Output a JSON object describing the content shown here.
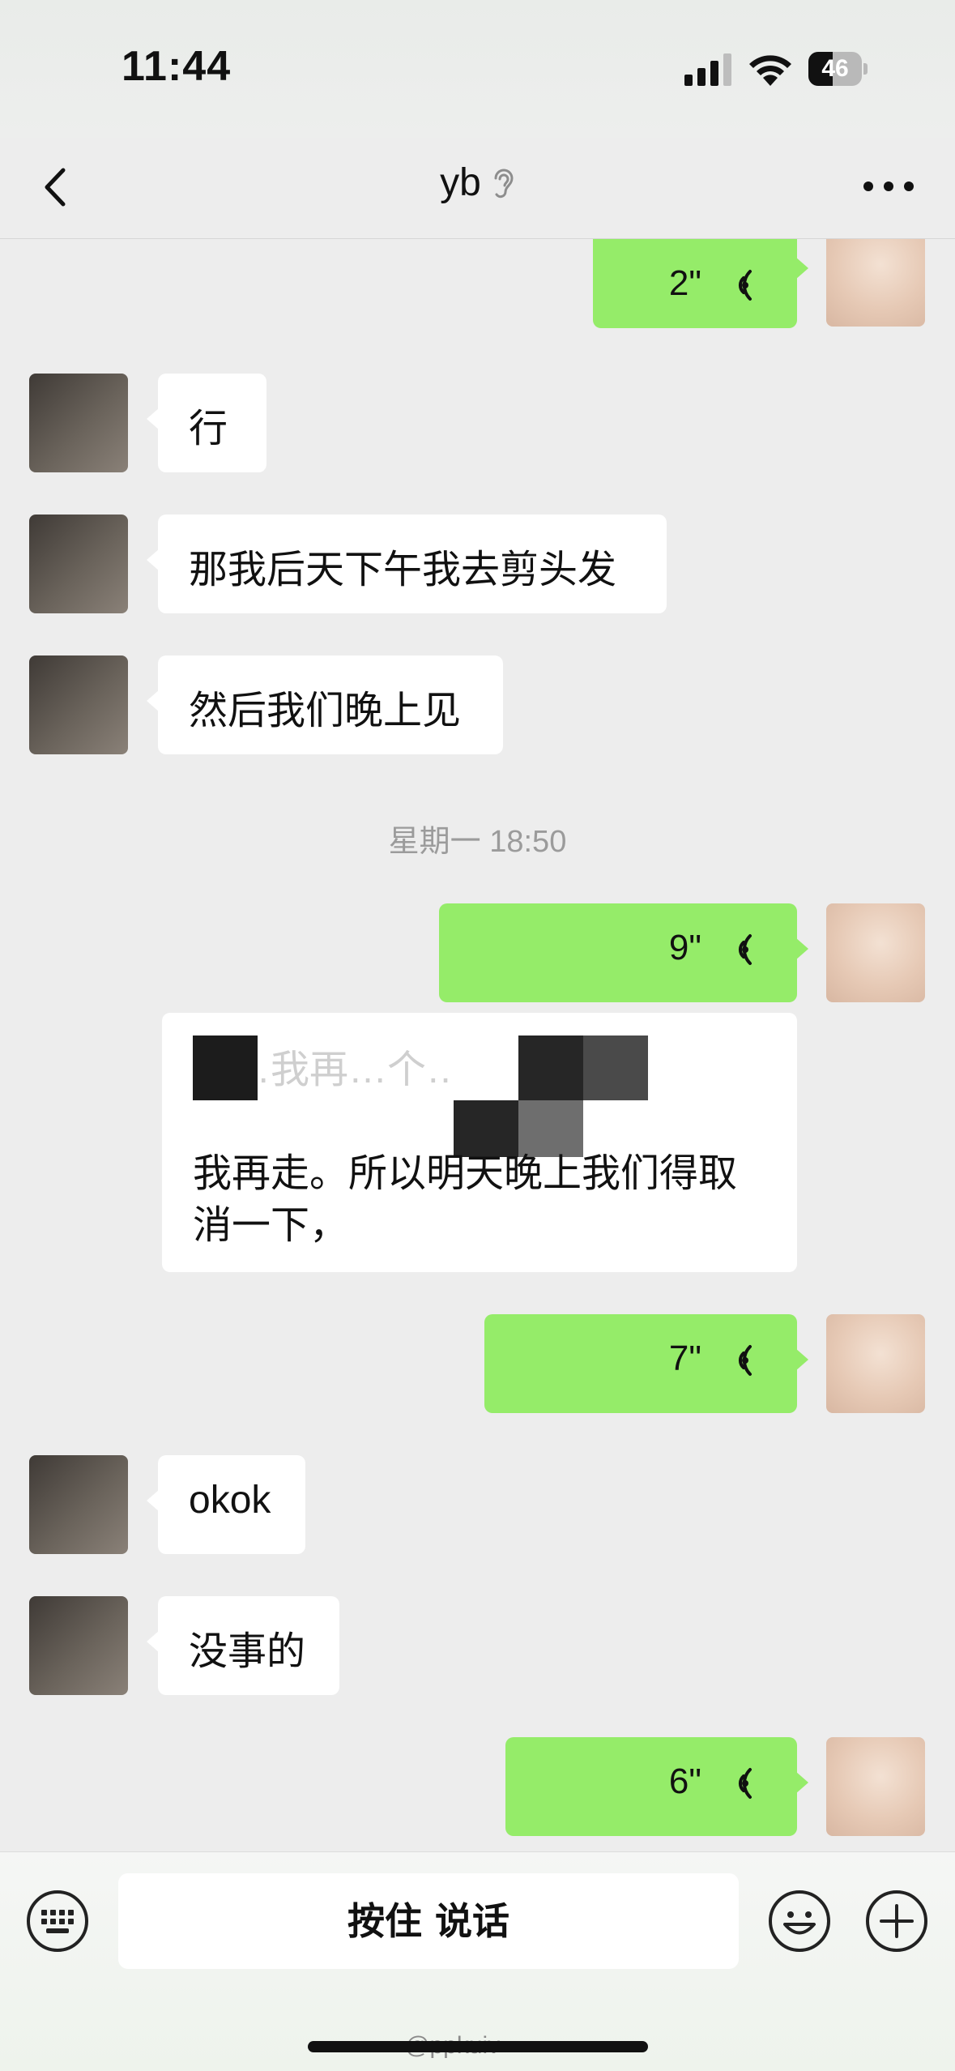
{
  "status_bar": {
    "time": "11:44",
    "battery": "46",
    "battery_level": 0.46
  },
  "header": {
    "title": "yb",
    "back_icon": "chevron-left-icon",
    "more_icon": "ellipsis-icon",
    "listen_mode_icon": "ear-icon"
  },
  "messages": {
    "voice_1": "2\"",
    "text_1": "行",
    "text_2": "那我后天下午我去剪头发",
    "text_3": "然后我们晚上见",
    "timestamp": "星期一 18:50",
    "voice_2": "9\"",
    "long_line_1": "明…我再…个…",
    "long_line_2": "我再走。所以明天晚上我们得取",
    "long_line_3": "消一下，",
    "voice_3": "7\"",
    "text_4": "okok",
    "text_5": "没事的",
    "voice_4": "6\""
  },
  "input_bar": {
    "hold_to_talk": "按住 说话",
    "keyboard_icon": "keyboard-icon",
    "emoji_icon": "emoji-icon",
    "plus_icon": "plus-icon"
  },
  "watermark": "@ppkuiv",
  "colors": {
    "outgoing_bubble": "#95ec69",
    "incoming_bubble": "#ffffff",
    "background": "#ededed"
  }
}
